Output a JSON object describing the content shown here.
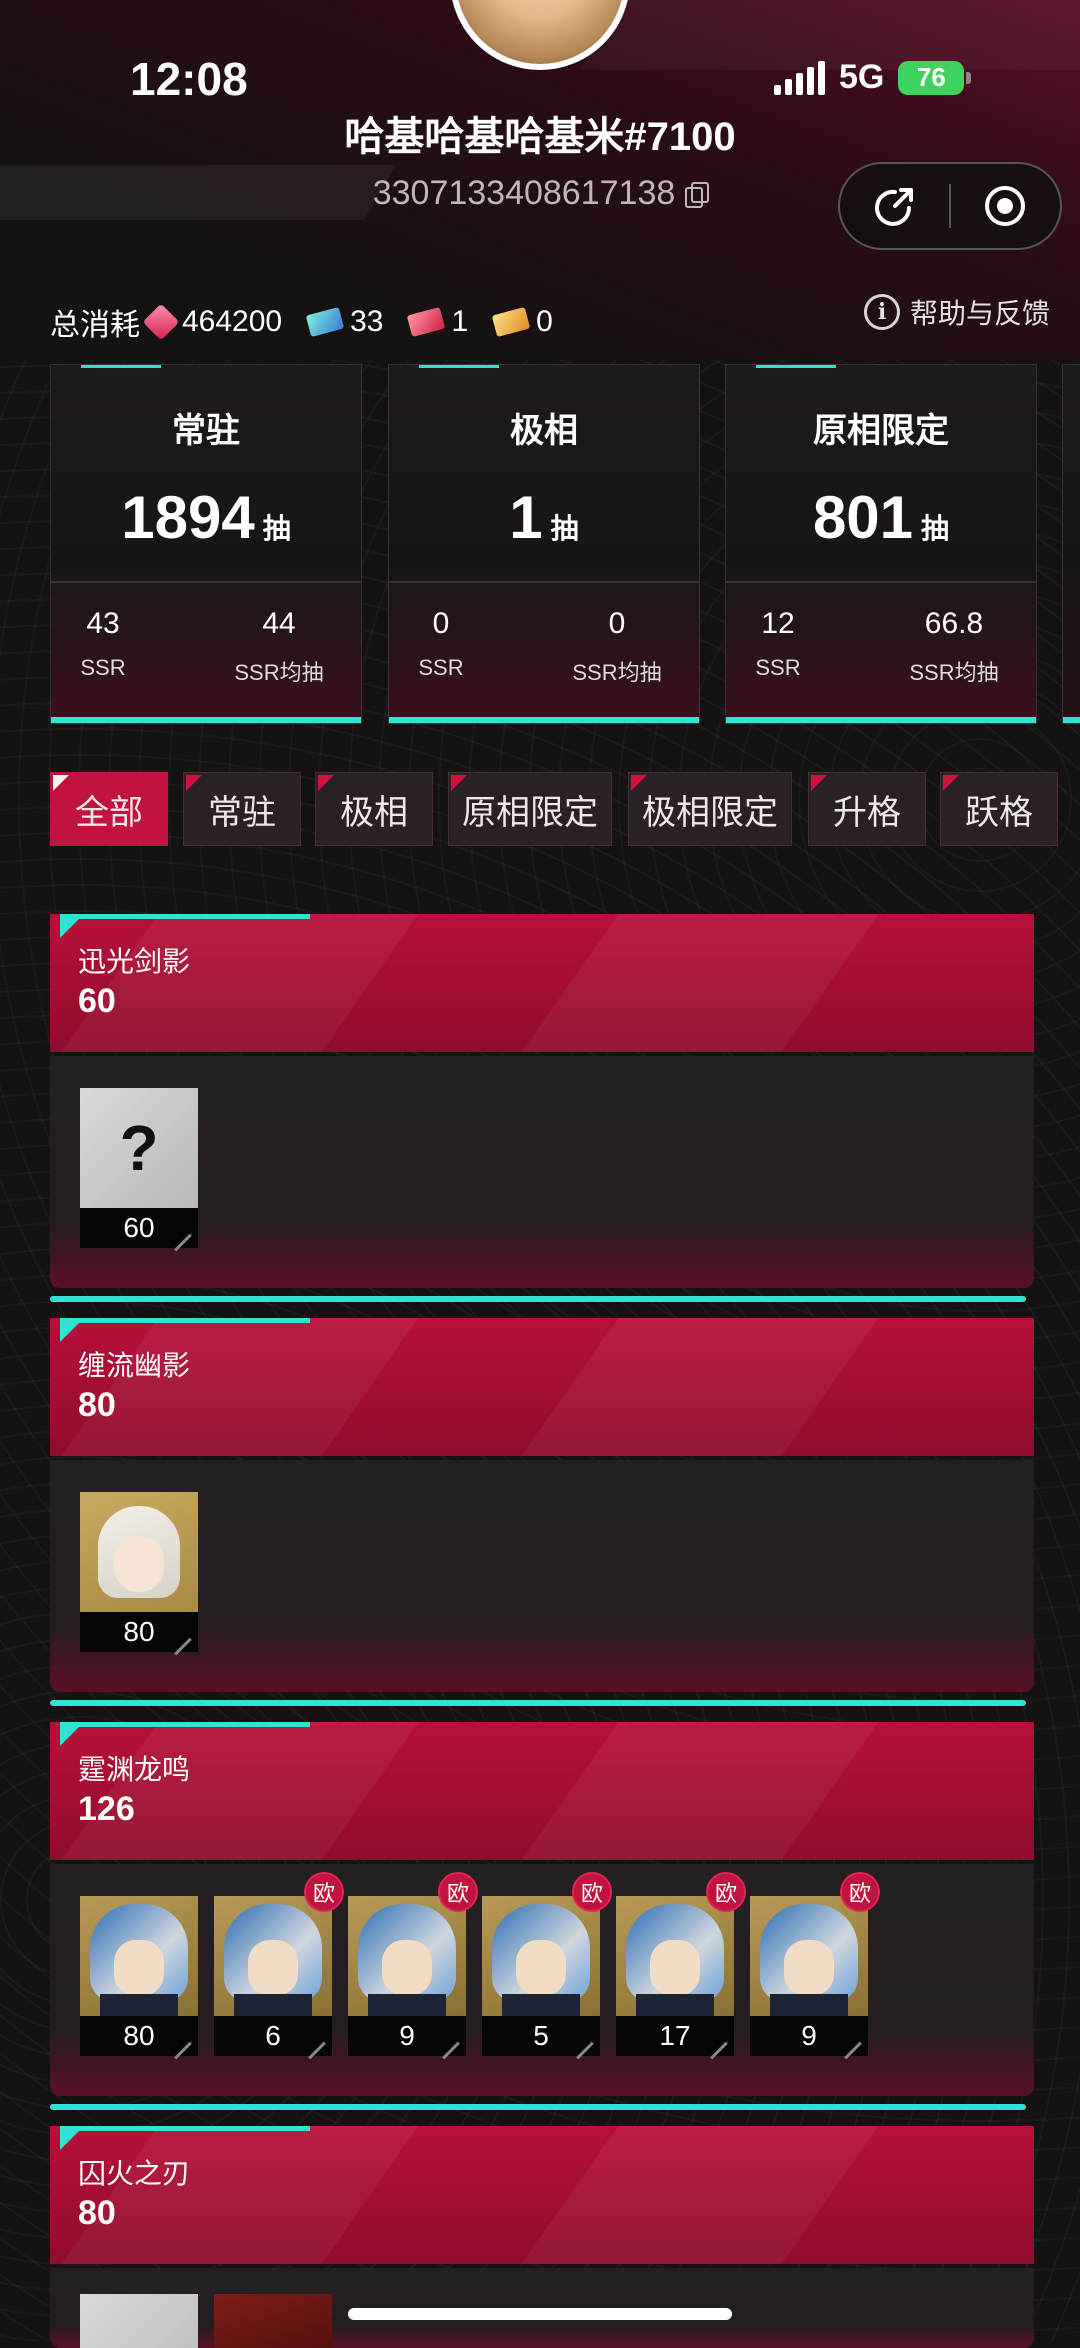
{
  "status_bar": {
    "time": "12:08",
    "network": "5G",
    "battery": "76"
  },
  "profile": {
    "username": "哈基哈基哈基米#7100",
    "uid": "3307133408617138"
  },
  "consumption": {
    "label": "总消耗",
    "items": [
      {
        "icon": "crystal-icon",
        "value": "464200"
      },
      {
        "icon": "standard-ticket-icon",
        "value": "33"
      },
      {
        "icon": "limited-ticket-icon",
        "value": "1"
      },
      {
        "icon": "weapon-ticket-icon",
        "value": "0"
      }
    ]
  },
  "help_label": "帮助与反馈",
  "stats": [
    {
      "name": "常驻",
      "pulls": "1894",
      "unit": "抽",
      "ssr": "43",
      "ssr_label": "SSR",
      "avg": "44",
      "avg_label": "SSR均抽"
    },
    {
      "name": "极相",
      "pulls": "1",
      "unit": "抽",
      "ssr": "0",
      "ssr_label": "SSR",
      "avg": "0",
      "avg_label": "SSR均抽"
    },
    {
      "name": "原相限定",
      "pulls": "801",
      "unit": "抽",
      "ssr": "12",
      "ssr_label": "SSR",
      "avg": "66.8",
      "avg_label": "SSR均抽"
    }
  ],
  "tabs": [
    "全部",
    "常驻",
    "极相",
    "原相限定",
    "极相限定",
    "升格",
    "跃格"
  ],
  "active_tab": "全部",
  "sections": [
    {
      "title": "迅光剑影",
      "total": "60",
      "chars": [
        {
          "type": "unknown",
          "label": "?",
          "count": "60",
          "badge": ""
        }
      ]
    },
    {
      "title": "缠流幽影",
      "total": "80",
      "chars": [
        {
          "type": "gold",
          "count": "80",
          "badge": ""
        }
      ]
    },
    {
      "title": "霆渊龙鸣",
      "total": "126",
      "chars": [
        {
          "type": "blue",
          "count": "80",
          "badge": ""
        },
        {
          "type": "blue",
          "count": "6",
          "badge": "欧"
        },
        {
          "type": "blue",
          "count": "9",
          "badge": "欧"
        },
        {
          "type": "blue",
          "count": "5",
          "badge": "欧"
        },
        {
          "type": "blue",
          "count": "17",
          "badge": "欧"
        },
        {
          "type": "blue",
          "count": "9",
          "badge": "欧"
        }
      ]
    },
    {
      "title": "囚火之刃",
      "total": "80",
      "chars": []
    }
  ],
  "colors": {
    "accent": "#c0143e",
    "cyan": "#2fe2d2",
    "background": "#151214"
  }
}
